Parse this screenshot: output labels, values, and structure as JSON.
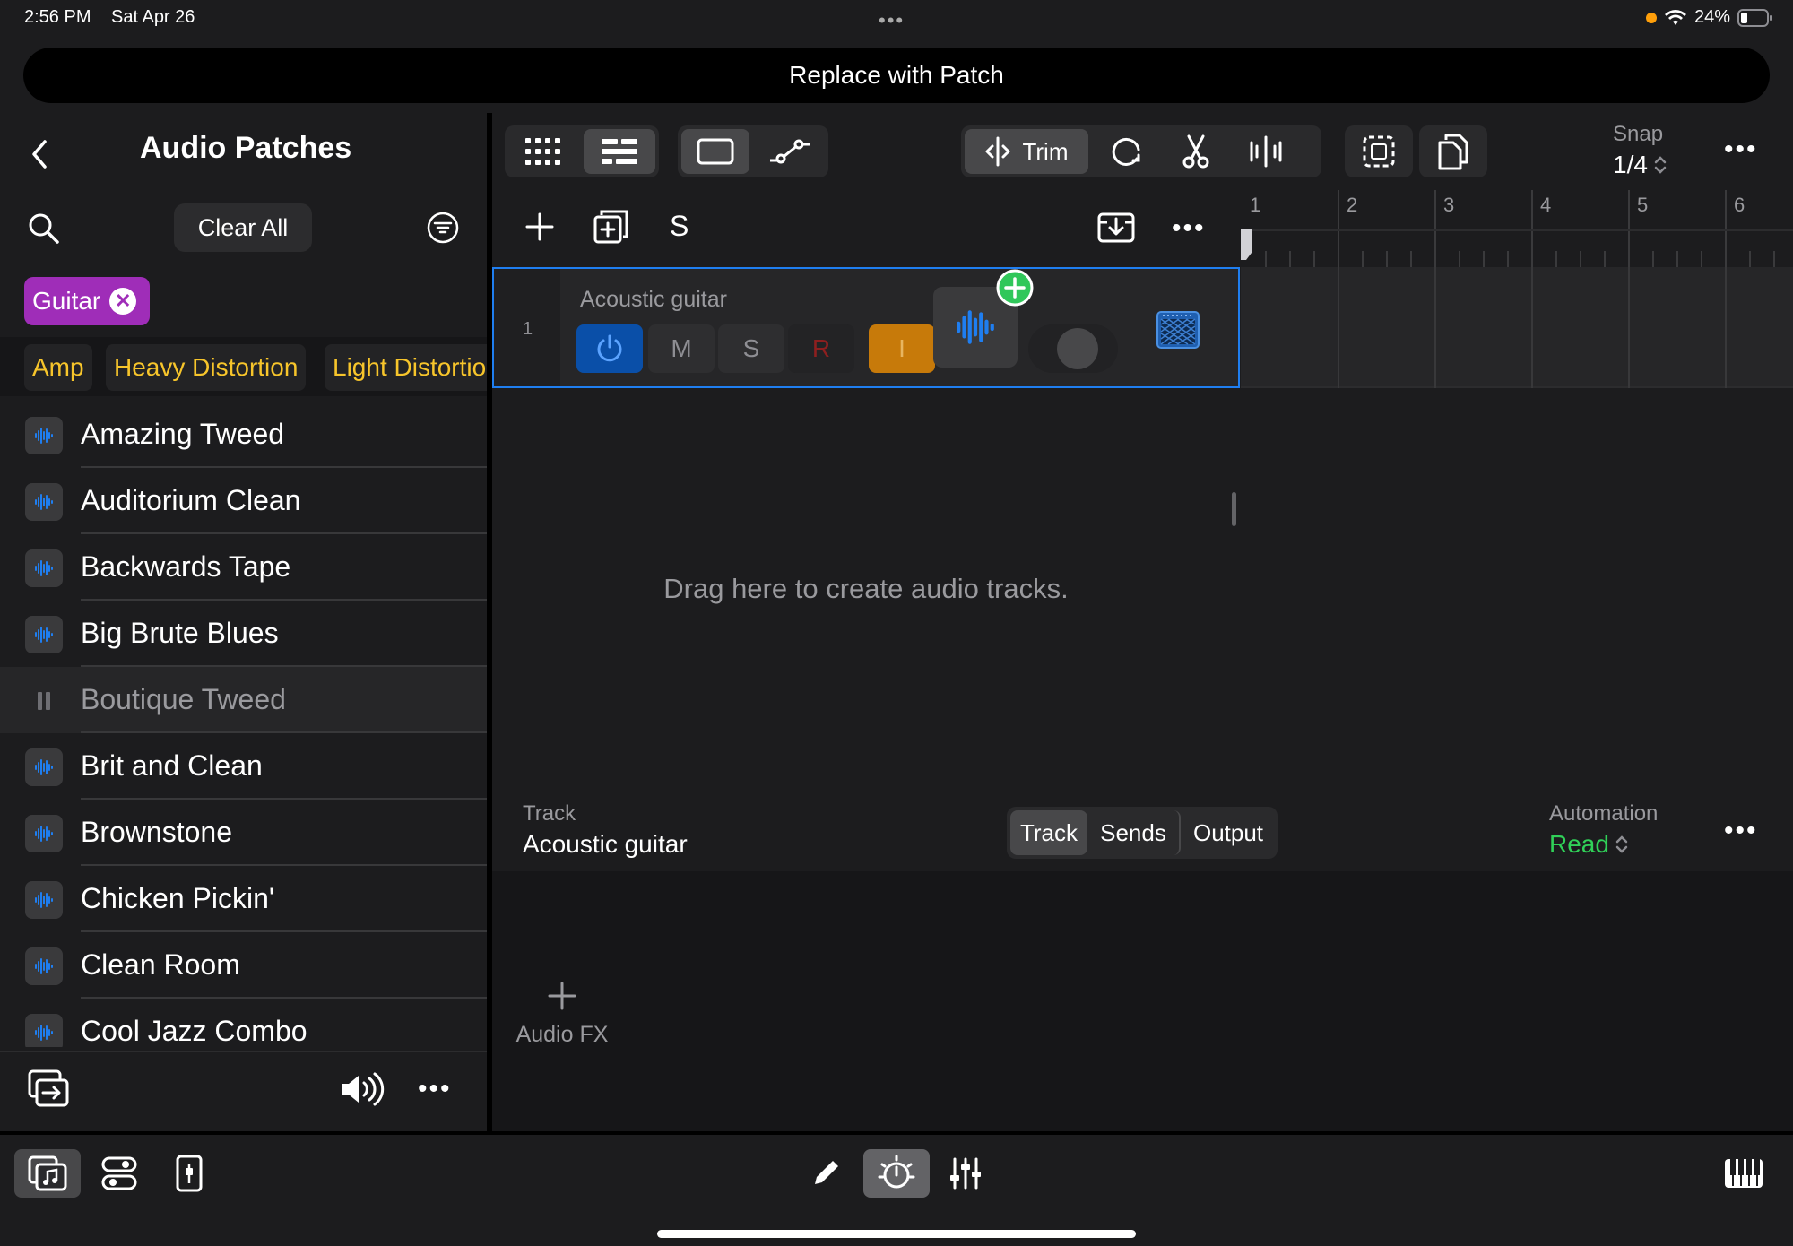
{
  "status": {
    "time": "2:56 PM",
    "date": "Sat Apr 26",
    "battery": "24%"
  },
  "replace_bar": {
    "label": "Replace with Patch"
  },
  "left_panel": {
    "title": "Audio Patches",
    "clear_all": "Clear All",
    "active_filter": "Guitar",
    "categories": [
      "Amp",
      "Heavy Distortion",
      "Light Distortion"
    ],
    "patches": [
      "Amazing Tweed",
      "Auditorium Clean",
      "Backwards Tape",
      "Big Brute Blues",
      "Boutique Tweed",
      "Brit and Clean",
      "Brownstone",
      "Chicken Pickin'",
      "Clean Room",
      "Cool Jazz Combo"
    ],
    "playing_patch": "Boutique Tweed"
  },
  "toolbar": {
    "trim_label": "Trim",
    "snap_label": "Snap",
    "snap_value": "1/4"
  },
  "track_header": {
    "solo_label": "S"
  },
  "ruler": {
    "bars": [
      "1",
      "2",
      "3",
      "4",
      "5",
      "6"
    ]
  },
  "track": {
    "number": "1",
    "name": "Acoustic guitar",
    "mute_label": "M",
    "solo_label": "S",
    "record_label": "R",
    "input_label": "I"
  },
  "empty_hint": "Drag here to create audio tracks.",
  "inspector": {
    "track_caption": "Track",
    "track_name": "Acoustic guitar",
    "tabs": [
      "Track",
      "Sends",
      "Output"
    ],
    "selected_tab": "Track",
    "automation_caption": "Automation",
    "automation_value": "Read",
    "audio_fx_label": "Audio FX"
  },
  "colors": {
    "accent_blue": "#1f7ef0",
    "tag_purple": "#9f2db8",
    "category_yellow": "#f7c52b",
    "input_orange": "#c77a0a",
    "automation_green": "#30d158",
    "record_red": "#c0392b"
  }
}
